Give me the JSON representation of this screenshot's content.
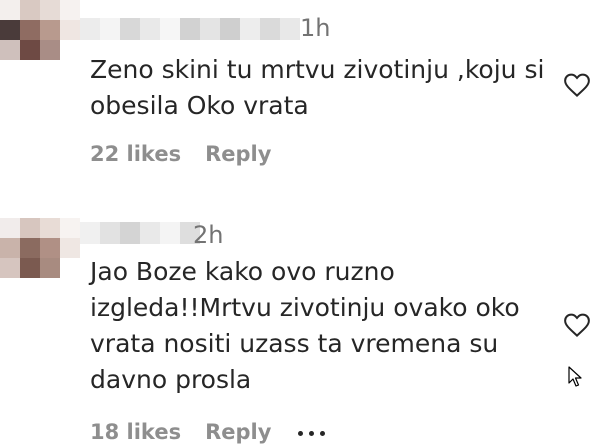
{
  "comments": [
    {
      "time": "1h",
      "text_lines": [
        "Zeno skini tu mrtvu zivotinju ,koju si",
        "obesila Oko vrata"
      ],
      "likes": "22 likes",
      "reply": "Reply"
    },
    {
      "time": "2h",
      "text_lines": [
        "Jao Boze kako ovo ruzno",
        "izgleda!!Mrtvu zivotinju ovako oko",
        "vrata nositi uzass ta vremena su",
        "davno prosla"
      ],
      "likes": "18 likes",
      "reply": "Reply"
    }
  ],
  "icons": {
    "like": "heart-outline-icon",
    "more": "ellipsis-icon",
    "cursor": "mouse-pointer-icon"
  },
  "colors": {
    "text": "#262626",
    "secondary": "#8e8e8e",
    "time": "#737373"
  }
}
